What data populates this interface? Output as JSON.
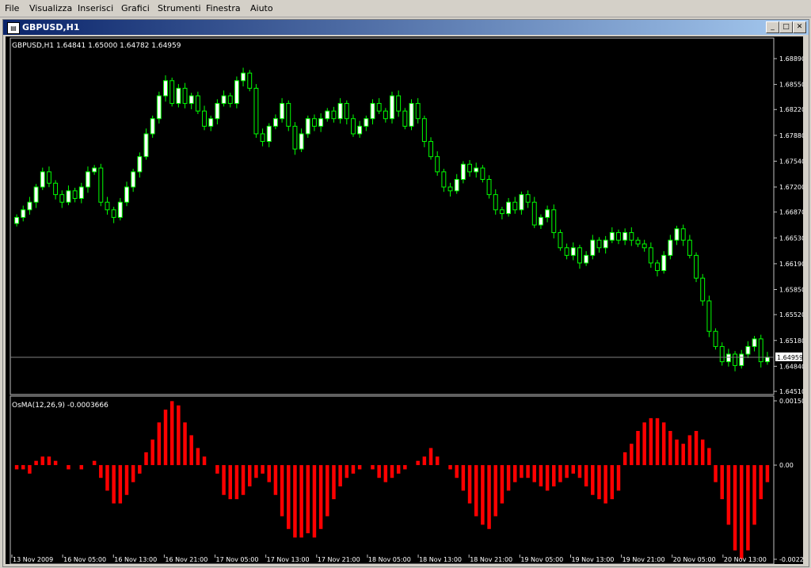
{
  "menu": [
    "File",
    "Visualizza",
    "Inserisci",
    "Grafici",
    "Strumenti",
    "Finestra",
    "Aiuto"
  ],
  "window": {
    "title": "GBPUSD,H1",
    "min_label": "_",
    "max_label": "□",
    "close_label": "✕"
  },
  "chart_data": [
    {
      "type": "candlestick",
      "info_label": "GBPUSD,H1  1.64841 1.65000 1.64782 1.64959",
      "price_ticks": [
        "1.68890",
        "1.68550",
        "1.68220",
        "1.67880",
        "1.67540",
        "1.67200",
        "1.66870",
        "1.66530",
        "1.66190",
        "1.65850",
        "1.65520",
        "1.65180",
        "1.64840",
        "1.64510"
      ],
      "ylim": [
        1.6451,
        1.6889
      ],
      "current_price": "1.64959",
      "closes": [
        1.668,
        1.669,
        1.67,
        1.672,
        1.674,
        1.6725,
        1.671,
        1.67,
        1.6715,
        1.6705,
        1.672,
        1.674,
        1.6745,
        1.67,
        1.669,
        1.668,
        1.67,
        1.672,
        1.674,
        1.676,
        1.679,
        1.681,
        1.684,
        1.686,
        1.683,
        1.685,
        1.683,
        1.684,
        1.682,
        1.68,
        1.681,
        1.683,
        1.684,
        1.683,
        1.686,
        1.687,
        1.685,
        1.679,
        1.678,
        1.68,
        1.681,
        1.683,
        1.68,
        1.677,
        1.679,
        1.681,
        1.68,
        1.681,
        1.682,
        1.681,
        1.683,
        1.681,
        1.679,
        1.68,
        1.681,
        1.683,
        1.682,
        1.681,
        1.684,
        1.682,
        1.68,
        1.683,
        1.681,
        1.678,
        1.676,
        1.674,
        1.672,
        1.6715,
        1.673,
        1.675,
        1.674,
        1.6745,
        1.673,
        1.671,
        1.669,
        1.6685,
        1.67,
        1.669,
        1.671,
        1.67,
        1.667,
        1.668,
        1.669,
        1.666,
        1.664,
        1.663,
        1.664,
        1.662,
        1.663,
        1.665,
        1.664,
        1.665,
        1.666,
        1.665,
        1.666,
        1.665,
        1.6645,
        1.664,
        1.662,
        1.661,
        1.663,
        1.665,
        1.6665,
        1.665,
        1.663,
        1.66,
        1.657,
        1.653,
        1.651,
        1.649,
        1.65,
        1.6485,
        1.65,
        1.651,
        1.652,
        1.649,
        1.6496
      ]
    },
    {
      "type": "bar",
      "label": "OsMA(12,26,9) -0.0003666",
      "ticks": [
        "0.001507",
        "0.00",
        "-0.00221"
      ],
      "ylim": [
        -0.00221,
        0.001507
      ],
      "values": [
        -0.0001,
        -0.0001,
        -0.0002,
        0.0001,
        0.0002,
        0.0002,
        0.0001,
        0.0,
        -0.0001,
        0.0,
        -0.0001,
        0.0,
        0.0001,
        -0.0003,
        -0.0006,
        -0.0009,
        -0.0009,
        -0.0007,
        -0.0004,
        -0.0002,
        0.0003,
        0.0006,
        0.001,
        0.0013,
        0.0015,
        0.0014,
        0.001,
        0.0007,
        0.0004,
        0.0002,
        0.0,
        -0.0002,
        -0.0007,
        -0.0008,
        -0.0008,
        -0.0007,
        -0.0005,
        -0.0003,
        -0.0002,
        -0.0004,
        -0.0007,
        -0.0012,
        -0.0015,
        -0.0017,
        -0.0017,
        -0.0016,
        -0.0017,
        -0.0015,
        -0.0012,
        -0.0008,
        -0.0005,
        -0.0003,
        -0.0002,
        -0.0001,
        0.0,
        -0.0001,
        -0.0003,
        -0.0004,
        -0.0003,
        -0.0002,
        -0.0001,
        0.0,
        0.0001,
        0.0002,
        0.0004,
        0.0002,
        0.0,
        -0.0001,
        -0.0003,
        -0.0006,
        -0.0009,
        -0.0012,
        -0.0014,
        -0.0015,
        -0.0012,
        -0.0009,
        -0.0006,
        -0.0004,
        -0.0003,
        -0.0003,
        -0.0004,
        -0.0005,
        -0.0006,
        -0.0005,
        -0.0004,
        -0.0003,
        -0.0002,
        -0.0003,
        -0.0005,
        -0.0007,
        -0.0008,
        -0.0009,
        -0.0008,
        -0.0006,
        0.0003,
        0.0005,
        0.0008,
        0.001,
        0.0011,
        0.0011,
        0.001,
        0.0008,
        0.0006,
        0.0005,
        0.0007,
        0.0008,
        0.0006,
        0.0004,
        -0.0004,
        -0.0008,
        -0.0014,
        -0.002,
        -0.0022,
        -0.002,
        -0.0014,
        -0.0008,
        -0.0004
      ]
    }
  ],
  "time_labels": [
    "13 Nov 2009",
    "16 Nov 05:00",
    "16 Nov 13:00",
    "16 Nov 21:00",
    "17 Nov 05:00",
    "17 Nov 13:00",
    "17 Nov 21:00",
    "18 Nov 05:00",
    "18 Nov 13:00",
    "18 Nov 21:00",
    "19 Nov 05:00",
    "19 Nov 13:00",
    "19 Nov 21:00",
    "20 Nov 05:00",
    "20 Nov 13:00"
  ],
  "colors": {
    "bull": "#ffffff",
    "bear": "#000000",
    "wick": "#00ff00",
    "osma": "#ff0000",
    "axis": "#c0c0c0",
    "text": "#ffffff",
    "bg": "#000000"
  }
}
